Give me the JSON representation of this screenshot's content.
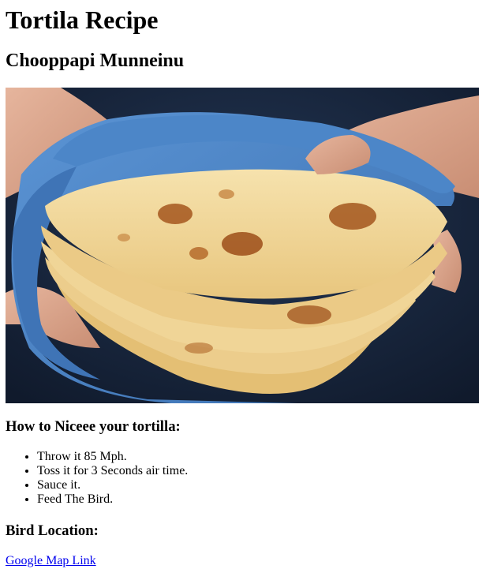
{
  "header": {
    "title": "Tortila Recipe",
    "subtitle": "Chooppapi Munneinu"
  },
  "image": {
    "subject": "tortilla-stack-photo",
    "colors": {
      "background": "#1b2a44",
      "towel": "#4a82c4",
      "tortilla": "#f0d79a",
      "char": "#a4541c",
      "skin": "#d9a48c"
    }
  },
  "instructions": {
    "heading": "How to Niceee your tortilla:",
    "items": [
      "Throw it 85 Mph.",
      "Toss it for 3 Seconds air time.",
      "Sauce it.",
      "Feed The Bird."
    ]
  },
  "location": {
    "heading": "Bird Location:",
    "link_text": "Google Map Link",
    "link_color": "#0000ee"
  }
}
